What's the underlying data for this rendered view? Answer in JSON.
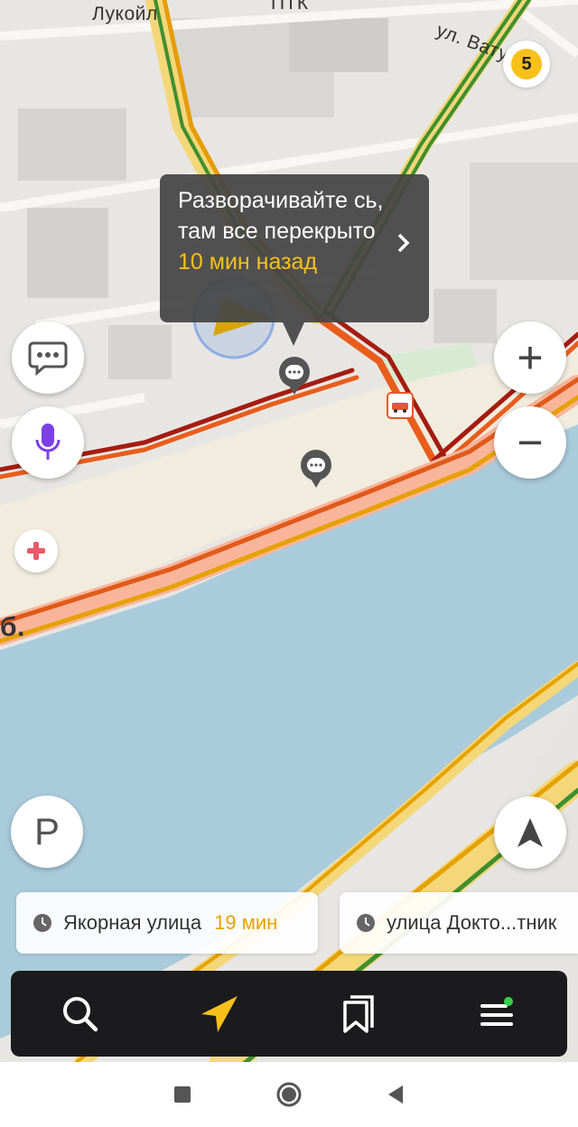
{
  "map": {
    "labels": {
      "top_left": "Лукойл",
      "top_mid": "ПТК",
      "top_right": "ул. Ватутина",
      "left_edge": "б."
    },
    "traffic_level": "5",
    "colors": {
      "water": "#a9cbdb",
      "land": "#e8e6e3",
      "block": "#d9d7d3",
      "park": "#d7ead2",
      "road_yellow": "#f8e6a8"
    }
  },
  "tooltip": {
    "message": "Разворачивайте сь, там все перекрыто",
    "time_ago": "10 мин назад",
    "icon": "chevron-right-icon"
  },
  "controls": {
    "chat": "chat-icon",
    "voice": "microphone-icon",
    "medical": "medical-cross-icon",
    "zoom_in": "+",
    "zoom_out": "−",
    "parking": "P",
    "compass": "compass-arrow-icon"
  },
  "destinations": [
    {
      "name": "Якорная улица",
      "eta": "19 мин"
    },
    {
      "name": "улица Докто...тник",
      "eta": ""
    }
  ],
  "tabbar": [
    "search-icon",
    "navigation-arrow-icon",
    "bookmarks-icon",
    "menu-icon"
  ],
  "system_nav": [
    "recent-apps-icon",
    "home-icon",
    "back-icon"
  ]
}
